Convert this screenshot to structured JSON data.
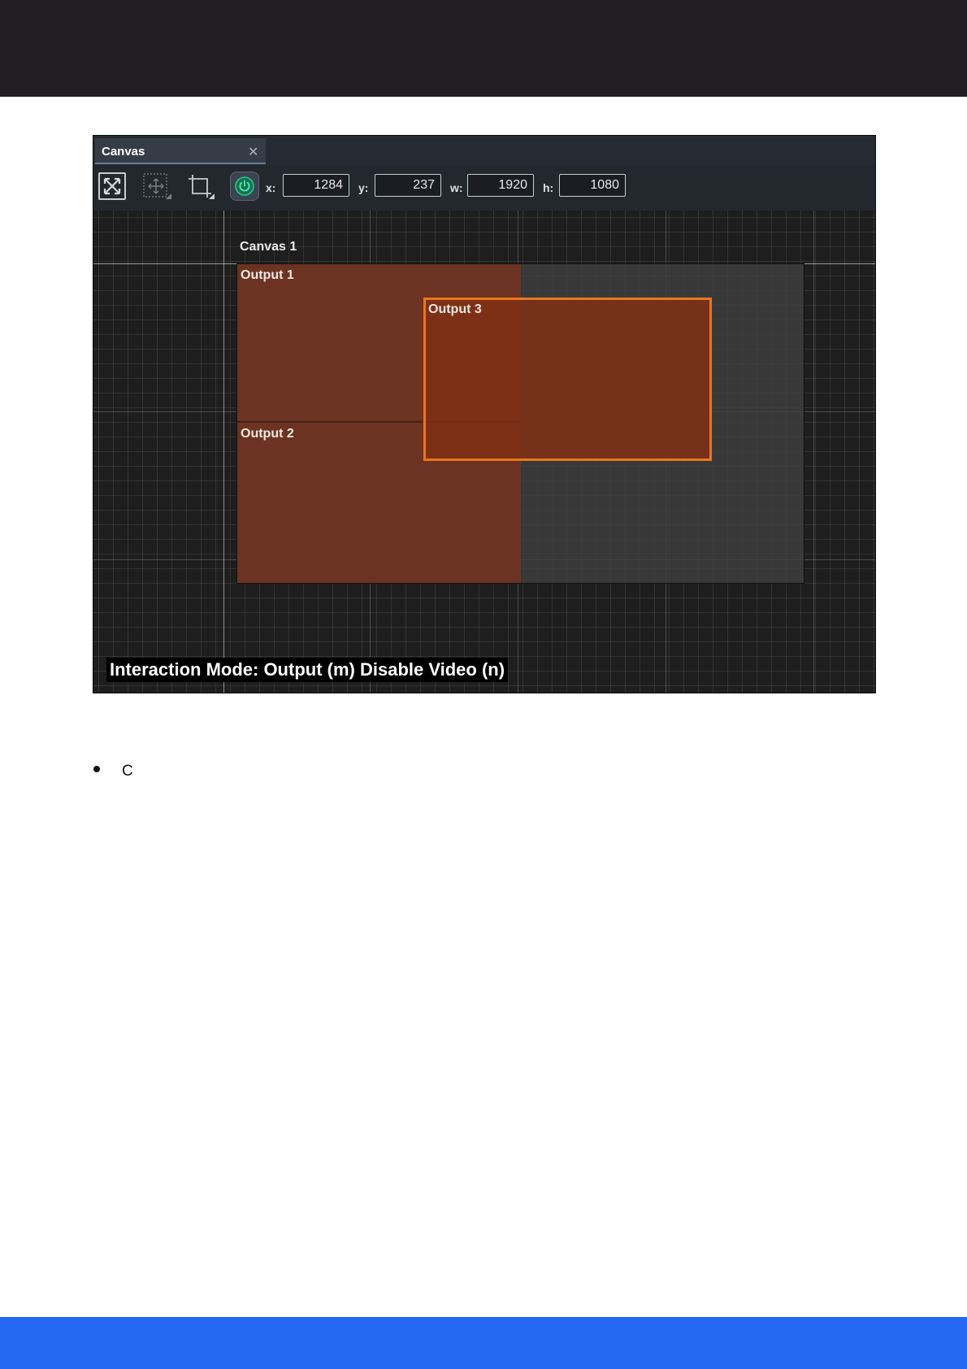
{
  "theme": {
    "top_band_color": "#221f23",
    "bottom_band_color": "#2468f2",
    "output_fill": "#6c3322",
    "selected_output_border": "#e8771c",
    "power_icon_color": "#23c98a"
  },
  "panel": {
    "tab_title": "Canvas",
    "close_icon": "close-icon"
  },
  "toolbar": {
    "tools": [
      "fit-to-view-icon",
      "move-icon",
      "crop-icon",
      "power-icon"
    ],
    "x_label": "x:",
    "x_value": "1284",
    "y_label": "y:",
    "y_value": "237",
    "w_label": "w:",
    "w_value": "1920",
    "h_label": "h:",
    "h_value": "1080"
  },
  "canvas": {
    "name": "Canvas 1",
    "outputs": [
      {
        "name": "Output 1"
      },
      {
        "name": "Output 2"
      },
      {
        "name": "Output 3",
        "selected": true
      }
    ]
  },
  "status_bar": {
    "text": "Interaction Mode: Output (m) Disable Video (n)"
  },
  "document": {
    "bullet_text": "C"
  }
}
